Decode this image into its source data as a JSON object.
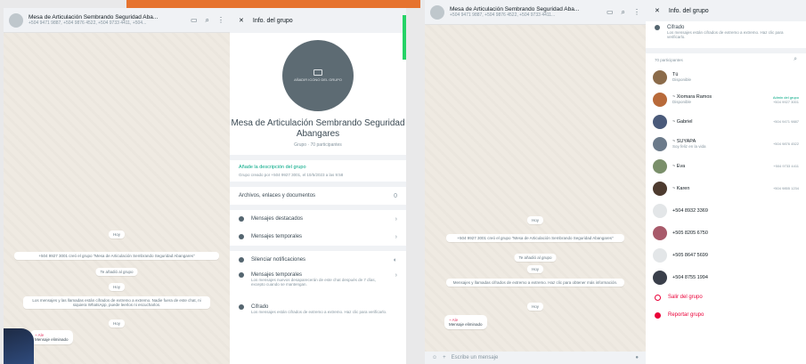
{
  "left": {
    "chat_header": {
      "title": "Mesa de Articulación Sembrando Seguridad Aba...",
      "subtitle": "+504 9471 9887, +504 9876 4522, +504 9733 4411, +504..."
    },
    "messages": [
      {
        "text": "Hoy"
      },
      {
        "text": "+504 9927 3001 creó el grupo \"Mesa de Articulación Sembrando Seguridad Abangares\""
      },
      {
        "text": "Te añadió al grupo"
      },
      {
        "text": "Hoy"
      },
      {
        "text": "Los mensajes y las llamadas están cifrados de extremo a extremo. Nadie fuera de este chat, ni siquiera WhatsApp, puede leerlos ni escucharlos."
      },
      {
        "text": "Hoy"
      }
    ],
    "bubble": {
      "who": "~ Ale",
      "text": "Mensaje eliminado"
    },
    "info": {
      "header_title": "Info. del grupo",
      "avatar_caption": "AÑADIR ICONO DEL GRUPO",
      "group_name": "Mesa de Articulación Sembrando Seguridad Abangares",
      "group_meta": "Grupo · 70 participantes",
      "add_description": "Añade la descripción del grupo",
      "created_by": "Grupo creado por +504 9927 3001, el 10/5/2023 a las 9:58",
      "media_label": "Archivos, enlaces y documentos",
      "media_count": "0",
      "starred": "Mensajes destacados",
      "settings": "Mensajes temporales",
      "mute": "Silenciar notificaciones",
      "disappearing": "Mensajes temporales",
      "disappearing_desc": "Los mensajes nuevos desaparecerán de este chat después de 7 días, excepto cuando se mantengan.",
      "encryption": "Cifrado",
      "encryption_desc": "Los mensajes están cifrados de extremo a extremo. Haz clic para verificarlo."
    }
  },
  "right": {
    "chat_header": {
      "title": "Mesa de Articulación Sembrando Seguridad Aba...",
      "subtitle": "+504 9471 9887, +504 9876 4522, +504 9733 4411..."
    },
    "messages": [
      {
        "text": "Hoy"
      },
      {
        "text": "+504 9927 3001 creó el grupo \"Mesa de Articulación Sembrando Seguridad Abangares\""
      },
      {
        "text": "Te añadió al grupo"
      },
      {
        "text": "Hoy"
      },
      {
        "text": "Mensajes y llamadas cifrados de extremo a extremo. Haz clic para obtener más información."
      },
      {
        "text": "Hoy"
      }
    ],
    "bubble": {
      "who": "~ Ale",
      "text": "Mensaje eliminado"
    },
    "composer_placeholder": "Escribe un mensaje",
    "info": {
      "header_title": "Info. del grupo",
      "encryption": "Cifrado",
      "encryption_desc": "Los mensajes están cifrados de extremo a extremo. Haz clic para verificarlo.",
      "participants_label": "70 participantes",
      "participants": [
        {
          "name": "Tú",
          "status": "Disponible",
          "right": "",
          "admin": false,
          "color": "#8b6b4a"
        },
        {
          "name": "~ Xiomara Ramos",
          "status": "Disponible",
          "right": "+504 9927 3001",
          "admin": true,
          "color": "#b86a3a"
        },
        {
          "name": "~ Gabriel",
          "status": "",
          "right": "+504 9471 9887",
          "admin": false,
          "color": "#4a5a7a"
        },
        {
          "name": "~ SUYAPA",
          "status": "Soy feliz en la vida",
          "right": "+504 9876 4522",
          "admin": false,
          "color": "#6b7a8a"
        },
        {
          "name": "~ Eva",
          "status": "",
          "right": "+504 9733 4411",
          "admin": false,
          "color": "#7a8f6a"
        },
        {
          "name": "~ Karen",
          "status": "",
          "right": "+504 9855 1234",
          "admin": false,
          "color": "#4d3b2f"
        },
        {
          "name": "+504 8932 3369",
          "status": "",
          "right": "",
          "admin": false,
          "color": "#e3e6e8"
        },
        {
          "name": "+505 8205 6750",
          "status": "",
          "right": "",
          "admin": false,
          "color": "#a85a6a"
        },
        {
          "name": "+505 8647 5699",
          "status": "",
          "right": "",
          "admin": false,
          "color": "#e3e6e8"
        },
        {
          "name": "+504 8755 1994",
          "status": "",
          "right": "",
          "admin": false,
          "color": "#3a3f4a"
        }
      ],
      "exit_group": "Salir del grupo",
      "report_group": "Reportar grupo"
    }
  }
}
